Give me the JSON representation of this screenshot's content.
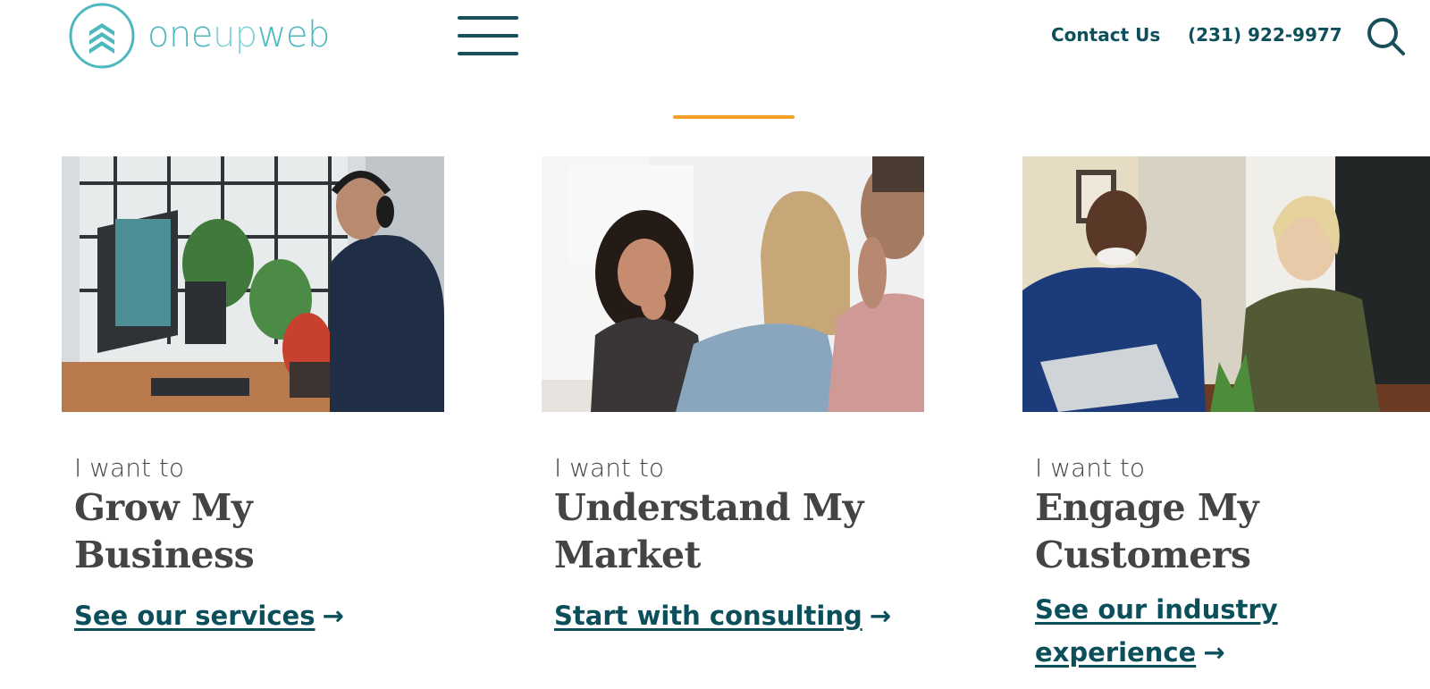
{
  "header": {
    "logo_text_one": "one",
    "logo_text_up": "up",
    "logo_text_web": "web",
    "menu_icon": "hamburger-menu-icon",
    "contact_label": "Contact Us",
    "phone_label": "(231) 922-9977",
    "search_icon": "search-icon"
  },
  "colors": {
    "brand_teal": "#4fb8bf",
    "dark_teal": "#0d4f5a",
    "accent_orange": "#f5a128",
    "headline_gray": "#444444"
  },
  "cards": [
    {
      "kicker": "I want to",
      "headline": "Grow My Business",
      "cta_label": "See our services",
      "cta_arrow": "→",
      "image": "man with headphones working at computer monitors"
    },
    {
      "kicker": "I want to",
      "headline": "Understand My Market",
      "cta_label": "Start with consulting",
      "cta_arrow": "→",
      "image": "team discussion around a table"
    },
    {
      "kicker": "I want to",
      "headline": "Engage My Customers",
      "cta_label": "See our industry experience",
      "cta_arrow": "→",
      "image": "two people looking at a tablet"
    }
  ]
}
